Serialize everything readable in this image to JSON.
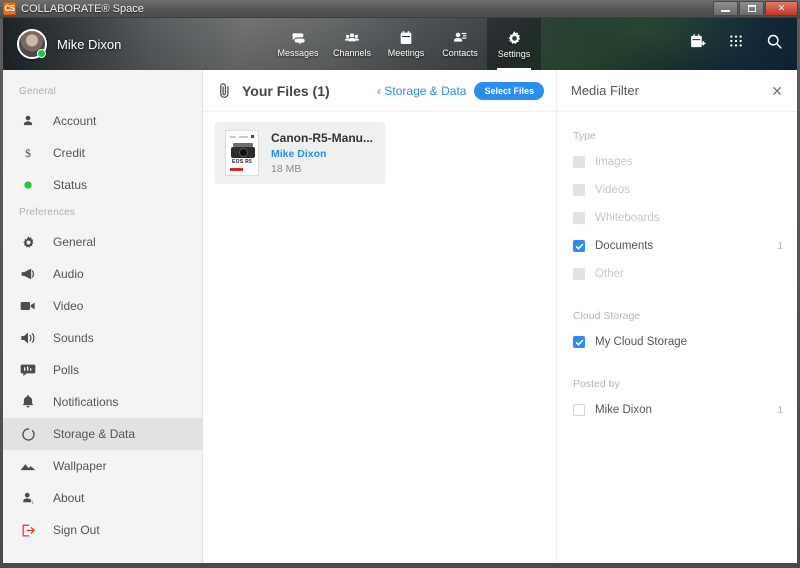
{
  "window": {
    "title": "COLLABORATE® Space",
    "app_icon": "cs-app-icon",
    "controls": {
      "minimize": "minimize-button",
      "maximize": "maximize-button",
      "close": "close-button"
    }
  },
  "header": {
    "user": {
      "name": "Mike Dixon",
      "status": "online",
      "status_color": "#25c24a"
    },
    "tabs": [
      {
        "label": "Messages",
        "icon": "messages-icon",
        "active": false
      },
      {
        "label": "Channels",
        "icon": "channels-icon",
        "active": false
      },
      {
        "label": "Meetings",
        "icon": "meetings-icon",
        "active": false
      },
      {
        "label": "Contacts",
        "icon": "contacts-icon",
        "active": false
      },
      {
        "label": "Settings",
        "icon": "settings-gear-icon",
        "active": true
      }
    ],
    "actions": [
      {
        "icon": "calendar-add-icon"
      },
      {
        "icon": "dialpad-icon"
      },
      {
        "icon": "search-icon"
      }
    ]
  },
  "sidebar": {
    "groups": [
      {
        "label": "General",
        "items": [
          {
            "label": "Account",
            "icon": "person-icon",
            "active": false
          },
          {
            "label": "Credit",
            "icon": "dollar-icon",
            "active": false
          },
          {
            "label": "Status",
            "icon": "status-dot-icon",
            "active": false
          }
        ]
      },
      {
        "label": "Preferences",
        "items": [
          {
            "label": "General",
            "icon": "gear-icon",
            "active": false
          },
          {
            "label": "Audio",
            "icon": "megaphone-icon",
            "active": false
          },
          {
            "label": "Video",
            "icon": "video-camera-icon",
            "active": false
          },
          {
            "label": "Sounds",
            "icon": "speaker-icon",
            "active": false
          },
          {
            "label": "Polls",
            "icon": "poll-chat-icon",
            "active": false
          },
          {
            "label": "Notifications",
            "icon": "bell-icon",
            "active": false
          },
          {
            "label": "Storage & Data",
            "icon": "storage-circle-icon",
            "active": true
          },
          {
            "label": "Wallpaper",
            "icon": "mountains-icon",
            "active": false
          },
          {
            "label": "About",
            "icon": "person-info-icon",
            "active": false
          },
          {
            "label": "Sign Out",
            "icon": "sign-out-icon",
            "active": false,
            "danger": true
          }
        ]
      }
    ]
  },
  "main": {
    "icon": "paperclip-icon",
    "title": "Your Files (1)",
    "back_link": "Storage & Data",
    "back_chevron": "chevron-left-icon",
    "select_button": "Select Files",
    "files": [
      {
        "name": "Canon-R5-Manu...",
        "author": "Mike Dixon",
        "size": "18 MB",
        "thumbnail": "canon-eos-r5-manual-cover",
        "thumbnail_model": "EOS R5"
      }
    ]
  },
  "filter_panel": {
    "title": "Media Filter",
    "close_icon": "close-icon",
    "groups": [
      {
        "label": "Type",
        "rows": [
          {
            "label": "Images",
            "checked": false,
            "disabled": true,
            "count": ""
          },
          {
            "label": "Videos",
            "checked": false,
            "disabled": true,
            "count": ""
          },
          {
            "label": "Whiteboards",
            "checked": false,
            "disabled": true,
            "count": ""
          },
          {
            "label": "Documents",
            "checked": true,
            "disabled": false,
            "count": "1"
          },
          {
            "label": "Other",
            "checked": false,
            "disabled": true,
            "count": ""
          }
        ]
      },
      {
        "label": "Cloud Storage",
        "rows": [
          {
            "label": "My Cloud Storage",
            "checked": true,
            "disabled": false,
            "count": ""
          }
        ]
      },
      {
        "label": "Posted by",
        "rows": [
          {
            "label": "Mike Dixon",
            "checked": false,
            "disabled": false,
            "count": "1"
          }
        ]
      }
    ]
  },
  "colors": {
    "accent_blue": "#2b8df0",
    "sidebar_bg": "#f4f4f4",
    "active_item": "#e2e2e2",
    "danger_red": "#e8342a",
    "online_green": "#25c24a"
  }
}
